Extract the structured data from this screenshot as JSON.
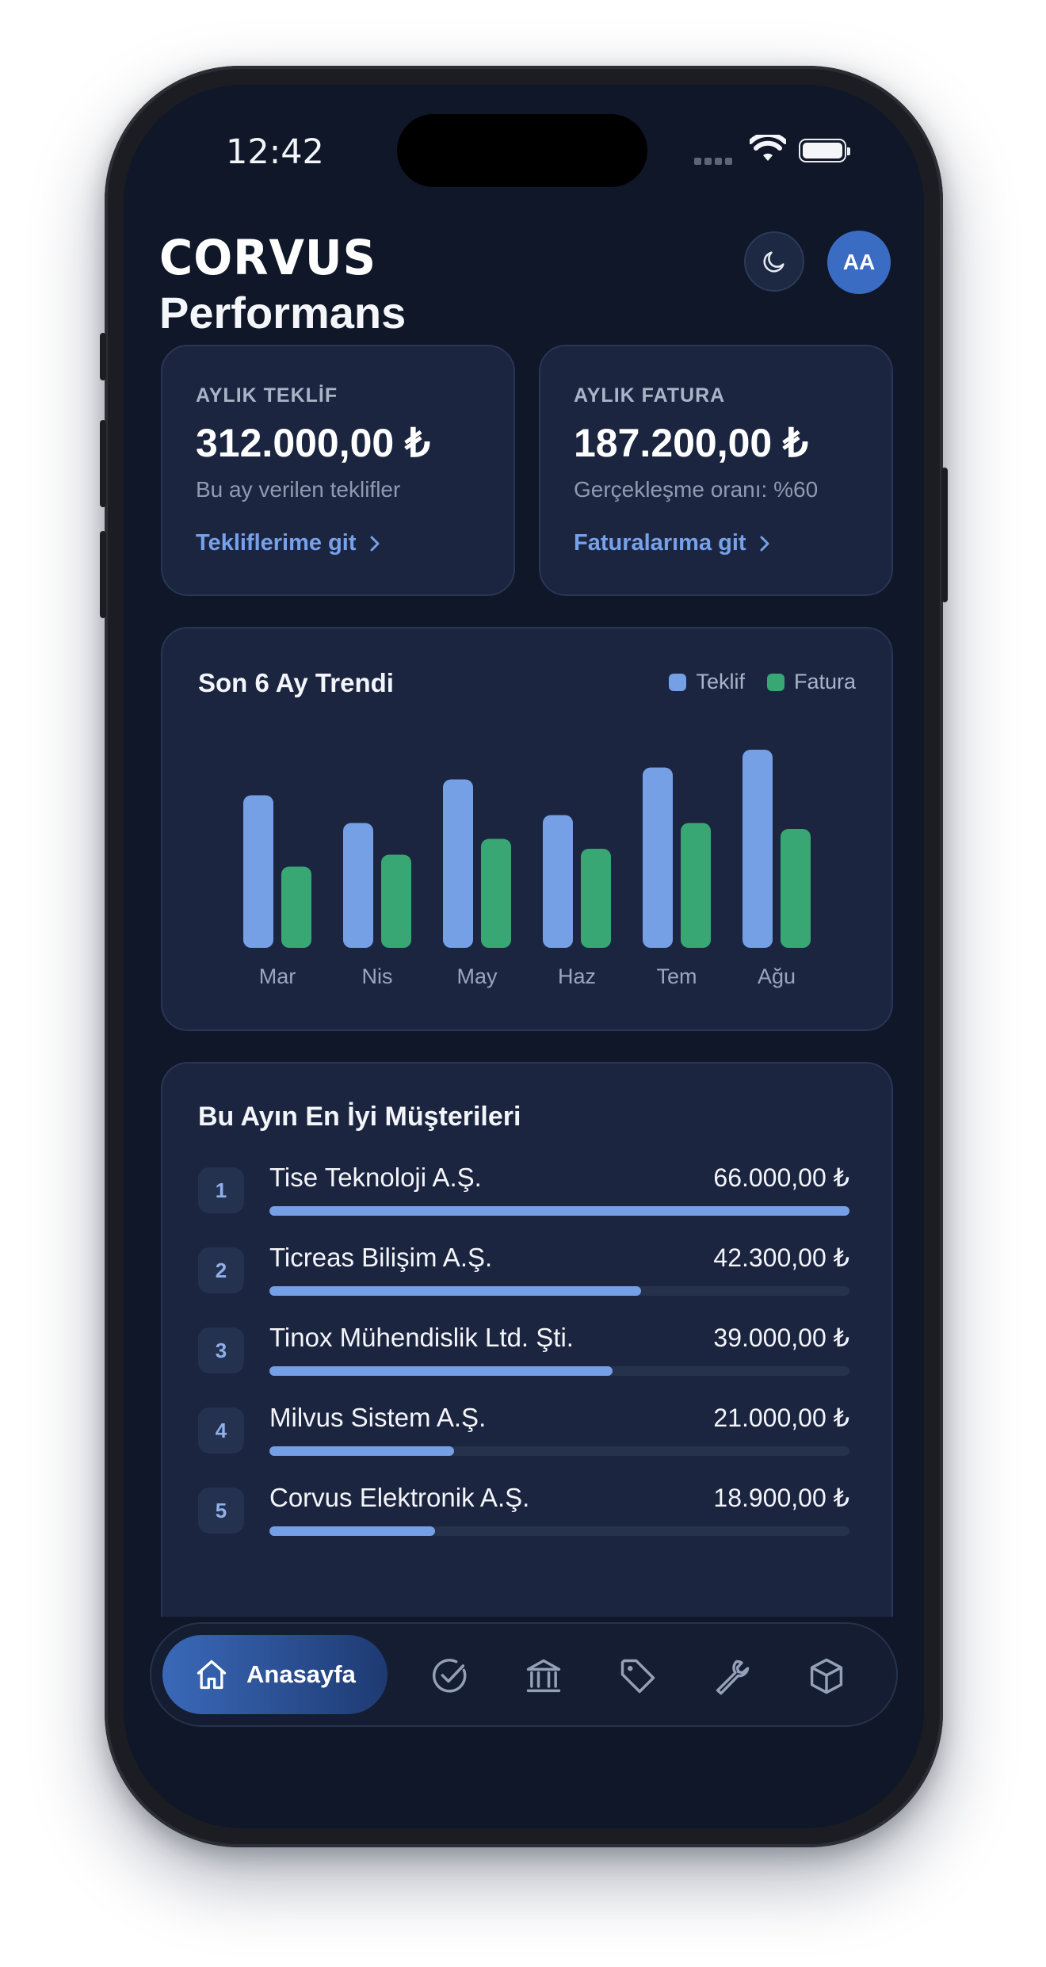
{
  "status_bar": {
    "time": "12:42"
  },
  "header": {
    "logo_text": "CORVUS",
    "avatar_initials": "AA",
    "page_title": "Performans"
  },
  "kpis": [
    {
      "label": "AYLIK TEKLİF",
      "value": "312.000,00 ₺",
      "subtitle": "Bu ay verilen teklifler",
      "link": "Tekliflerime git"
    },
    {
      "label": "AYLIK FATURA",
      "value": "187.200,00 ₺",
      "subtitle": "Gerçekleşme oranı: %60",
      "link": "Faturalarıma git"
    }
  ],
  "chart_data": {
    "type": "bar",
    "title": "Son 6 Ay Trendi",
    "categories": [
      "Mar",
      "Nis",
      "May",
      "Haz",
      "Tem",
      "Ağu"
    ],
    "series": [
      {
        "name": "Teklif",
        "color": "#75a0e6",
        "values": [
          0.77,
          0.63,
          0.85,
          0.67,
          0.91,
          1.0
        ]
      },
      {
        "name": "Fatura",
        "color": "#38a774",
        "values": [
          0.41,
          0.47,
          0.55,
          0.5,
          0.63,
          0.6
        ]
      }
    ],
    "ylim": [
      0,
      1
    ],
    "grid": false,
    "legend": "top-right"
  },
  "top_customers": {
    "title": "Bu Ayın En İyi Müşterileri",
    "items": [
      {
        "rank": "1",
        "name": "Tise Teknoloji A.Ş.",
        "amount": "66.000,00 ₺",
        "share": 1.0
      },
      {
        "rank": "2",
        "name": "Ticreas Bilişim A.Ş.",
        "amount": "42.300,00 ₺",
        "share": 0.641
      },
      {
        "rank": "3",
        "name": "Tinox Mühendislik Ltd. Şti.",
        "amount": "39.000,00 ₺",
        "share": 0.591
      },
      {
        "rank": "4",
        "name": "Milvus Sistem A.Ş.",
        "amount": "21.000,00 ₺",
        "share": 0.318
      },
      {
        "rank": "5",
        "name": "Corvus Elektronik A.Ş.",
        "amount": "18.900,00 ₺",
        "share": 0.286
      }
    ]
  },
  "bottom_nav": {
    "home_label": "Anasayfa",
    "icons": [
      "check-circle-icon",
      "bank-icon",
      "tag-icon",
      "wrench-icon",
      "cube-icon"
    ]
  }
}
